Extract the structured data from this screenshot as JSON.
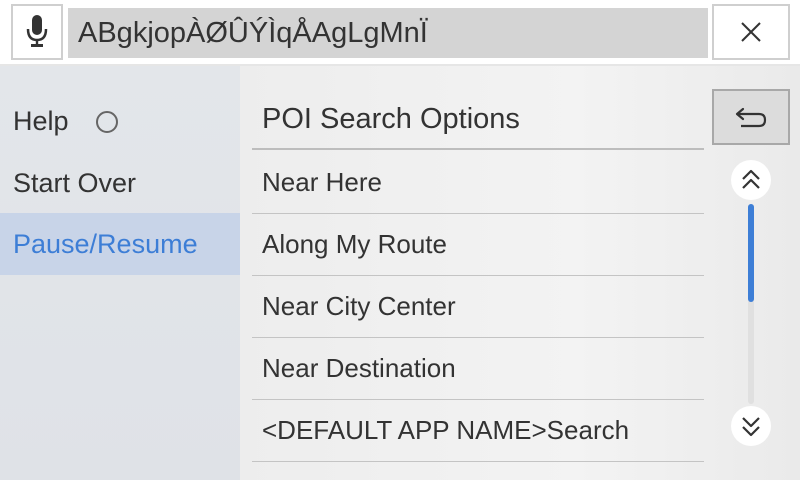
{
  "search": {
    "query": "ABgkjopÀØÛÝÌqÅAgLgMnÏ"
  },
  "icons": {
    "mic": "microphone-icon",
    "close": "close-icon",
    "back": "back-arrow-icon",
    "scroll_up": "double-chevron-up-icon",
    "scroll_down": "double-chevron-down-icon"
  },
  "left_menu": {
    "items": [
      {
        "label": "Help"
      },
      {
        "label": "Start Over"
      },
      {
        "label": "Pause/Resume",
        "selected": true
      }
    ]
  },
  "panel": {
    "title": "POI Search Options",
    "options": [
      {
        "label": "Near Here"
      },
      {
        "label": "Along My Route"
      },
      {
        "label": "Near City Center"
      },
      {
        "label": "Near Destination"
      },
      {
        "label": "<DEFAULT APP NAME>Search"
      }
    ]
  },
  "scrollbar": {
    "position_fraction": 0.0,
    "visible_fraction": 0.49
  },
  "colors": {
    "accent": "#3d7ed6",
    "selected_bg": "#c8d4e8",
    "field_bg": "#d4d4d4"
  }
}
